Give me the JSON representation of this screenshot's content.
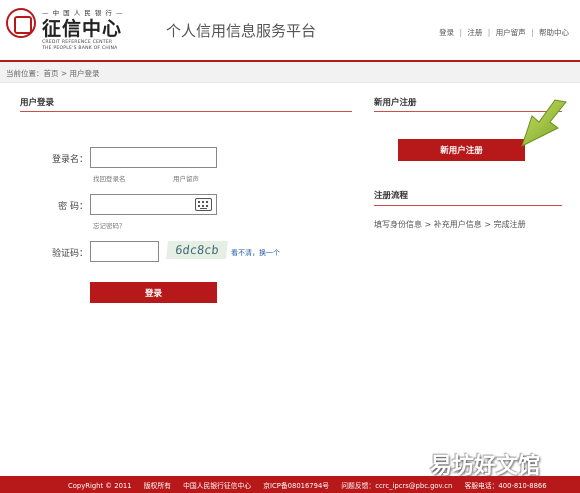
{
  "header": {
    "logo_top": "— 中 国 人 民 银 行 —",
    "logo_cn": "征信中心",
    "logo_en_line1": "CREDIT REFERENCE CENTER",
    "logo_en_line2": "THE PEOPLE'S BANK OF CHINA",
    "platform_title": "个人信用信息服务平台",
    "links": [
      "登录",
      "注册",
      "用户留声",
      "帮助中心"
    ],
    "separator": "|",
    "brand_color": "#b7191a"
  },
  "breadcrumb": "当前位置：首页 > 用户登录",
  "login": {
    "section_title": "用户登录",
    "username_label": "登录名：",
    "username_value": "",
    "find_username": "找回登录名",
    "user_voice": "用户留声",
    "password_label": "密  码：",
    "password_value": "",
    "forgot_password": "忘记密码？",
    "captcha_label": "验证码：",
    "captcha_value": "",
    "captcha_text": "6dc8cb",
    "captcha_refresh": "看不清，换一个",
    "login_button": "登录"
  },
  "register": {
    "section_title": "新用户注册",
    "register_button": "新用户注册",
    "flow_title": "注册流程",
    "flow_steps": "填写身份信息 > 补充用户信息 > 完成注册"
  },
  "footer": {
    "copyright": "CopyRight © 2011",
    "rights": "版权所有",
    "owner": "中国人民银行征信中心",
    "icp": "京ICP备08016794号",
    "feedback": "问题反馈：ccrc_ipcrs@pbc.gov.cn",
    "hotline": "客服电话：400-810-8866"
  },
  "watermark": "易坊好文馆"
}
